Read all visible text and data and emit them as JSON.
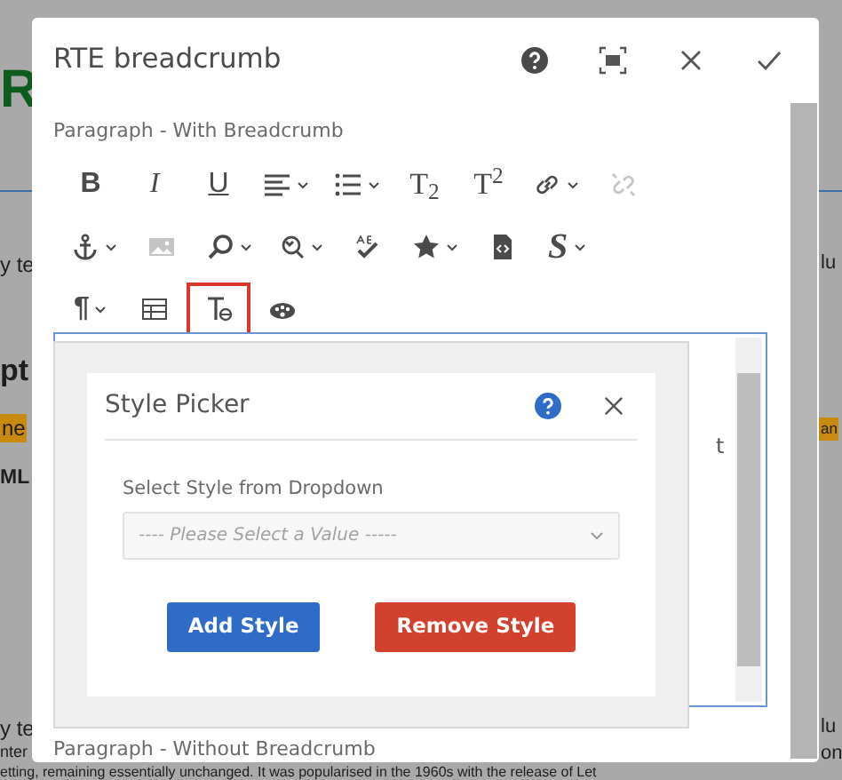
{
  "background_page": {
    "fragments": [
      {
        "text": "R",
        "kind": "heading"
      },
      {
        "text": "y te",
        "kind": "text"
      },
      {
        "text": "lu",
        "kind": "text"
      },
      {
        "text": "pt",
        "kind": "subheading"
      },
      {
        "text": "ne",
        "kind": "tag"
      },
      {
        "text": "an",
        "kind": "tag"
      },
      {
        "text": "ML",
        "kind": "subheading"
      },
      {
        "text": "y te",
        "kind": "text"
      },
      {
        "text": "lu",
        "kind": "text"
      },
      {
        "text": "nter",
        "kind": "text"
      },
      {
        "text": "on",
        "kind": "text"
      },
      {
        "text": "etting, remaining essentially unchanged. It was popularised in the 1960s with the release of Let",
        "kind": "text"
      }
    ]
  },
  "dialog": {
    "title": "RTE breadcrumb",
    "actions": [
      {
        "kind": "help"
      },
      {
        "kind": "fullscreen"
      },
      {
        "kind": "close"
      },
      {
        "kind": "confirm"
      }
    ],
    "section_label": "Paragraph - With Breadcrumb",
    "toolbar": [
      [
        {
          "kind": "bold",
          "glyph": "B",
          "dropdown": false,
          "disabled": false,
          "selected": false
        },
        {
          "kind": "italic",
          "glyph": "I",
          "dropdown": false,
          "disabled": false,
          "selected": false
        },
        {
          "kind": "underline",
          "glyph": "U",
          "dropdown": false,
          "disabled": false,
          "selected": false
        },
        {
          "kind": "align",
          "dropdown": true,
          "disabled": false,
          "selected": false
        },
        {
          "kind": "list",
          "dropdown": true,
          "disabled": false,
          "selected": false
        },
        {
          "kind": "subscript",
          "glyph": "T$_{2}$",
          "dropdown": false,
          "disabled": false,
          "selected": false
        },
        {
          "kind": "superscript",
          "glyph": "T$^{2}$",
          "dropdown": false,
          "disabled": false,
          "selected": false
        },
        {
          "kind": "link",
          "dropdown": true,
          "disabled": false,
          "selected": false
        },
        {
          "kind": "unlink",
          "dropdown": false,
          "disabled": true,
          "selected": false
        }
      ],
      [
        {
          "kind": "anchor",
          "dropdown": true,
          "disabled": false,
          "selected": false
        },
        {
          "kind": "image",
          "dropdown": false,
          "disabled": true,
          "selected": false
        },
        {
          "kind": "find",
          "dropdown": true,
          "disabled": false,
          "selected": false
        },
        {
          "kind": "replace",
          "dropdown": true,
          "disabled": false,
          "selected": false
        },
        {
          "kind": "spellcheck",
          "dropdown": false,
          "disabled": false,
          "selected": false
        },
        {
          "kind": "star",
          "dropdown": true,
          "disabled": false,
          "selected": false
        },
        {
          "kind": "source",
          "dropdown": false,
          "disabled": false,
          "selected": false
        },
        {
          "kind": "styles",
          "glyph": "S",
          "dropdown": true,
          "disabled": false,
          "selected": false
        }
      ],
      [
        {
          "kind": "paragraph",
          "glyph": "¶",
          "dropdown": true,
          "disabled": false,
          "selected": false
        },
        {
          "kind": "table",
          "dropdown": false,
          "disabled": false,
          "selected": false
        },
        {
          "kind": "stylepicker",
          "dropdown": false,
          "disabled": false,
          "selected": true
        },
        {
          "kind": "palette",
          "dropdown": false,
          "disabled": false,
          "selected": false
        }
      ]
    ],
    "editor": {
      "fragment": "t"
    },
    "style_picker": {
      "title": "Style Picker",
      "field_label": "Select Style from Dropdown",
      "placeholder": "---- Please Select a Value -----",
      "buttons": [
        {
          "label": "Add Style",
          "kind": "primary"
        },
        {
          "label": "Remove Style",
          "kind": "danger"
        }
      ]
    },
    "footer_label": "Paragraph - Without Breadcrumb"
  }
}
